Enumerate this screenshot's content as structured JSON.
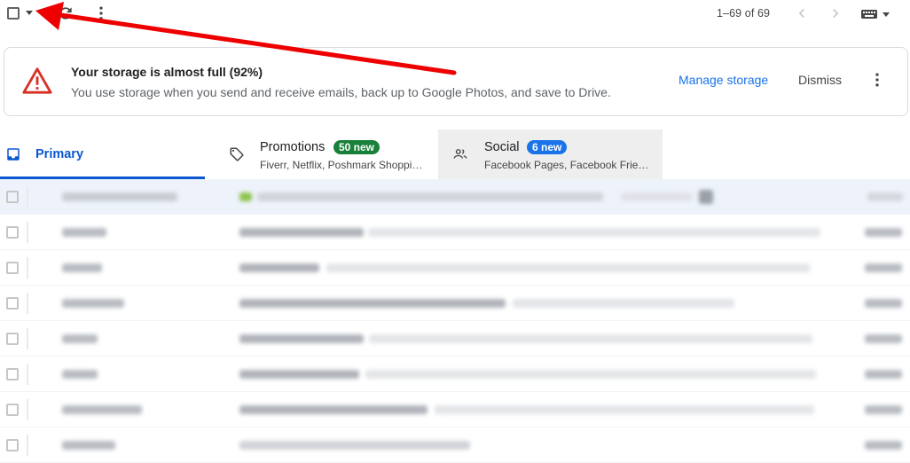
{
  "toolbar": {
    "select_all_icon": "checkbox-icon",
    "select_dropdown_icon": "caret-down-icon",
    "refresh_icon": "refresh-icon",
    "more_icon": "more-vertical-icon",
    "pagination": "1–69 of 69",
    "prev_icon": "chevron-left-icon",
    "next_icon": "chevron-right-icon",
    "keyboard_icon": "keyboard-icon"
  },
  "storage_banner": {
    "icon": "warning-icon",
    "title": "Your storage is almost full (92%)",
    "description": "You use storage when you send and receive emails, back up to Google Photos, and save to Drive.",
    "manage_label": "Manage storage",
    "dismiss_label": "Dismiss",
    "more_icon": "more-vertical-icon",
    "warning_color": "#d93025",
    "link_color": "#1a73e8"
  },
  "tabs": [
    {
      "label": "Primary",
      "icon": "inbox-icon",
      "selected": true,
      "color": "#0b57d0"
    },
    {
      "label": "Promotions",
      "icon": "tag-icon",
      "badge": "50 new",
      "badge_color": "#188038",
      "subtitle": "Fiverr, Netflix, Poshmark Shoppi…"
    },
    {
      "label": "Social",
      "icon": "people-icon",
      "badge": "6 new",
      "badge_color": "#1a73e8",
      "subtitle": "Facebook Pages, Facebook Frie…"
    }
  ],
  "email_list": {
    "row_count": 8,
    "content_blurred": true
  },
  "annotation": {
    "type": "arrow",
    "color": "#ee0000",
    "points_to": "select-dropdown"
  }
}
